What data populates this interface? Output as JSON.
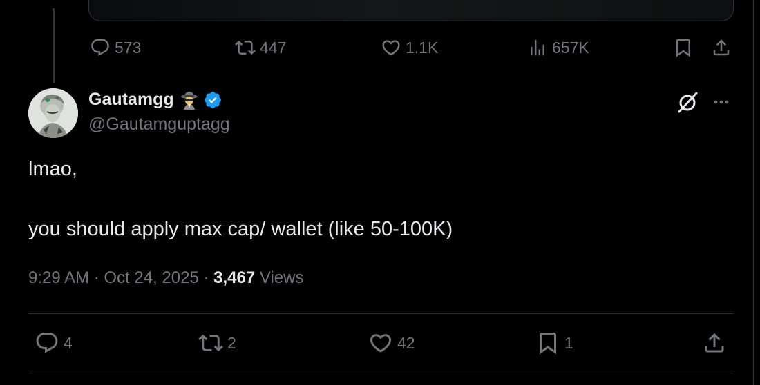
{
  "previous_post": {
    "actions": {
      "replies": "573",
      "reposts": "447",
      "likes": "1.1K",
      "views": "657K"
    }
  },
  "post": {
    "author": {
      "name": "Gautamgg",
      "handle": "@Gautamguptagg",
      "verified": true,
      "verified_color": "#1d9bf0"
    },
    "text_lines": [
      "lmao,",
      "you should apply max cap/ wallet (like 50-100K)"
    ],
    "meta": {
      "time": "9:29 AM",
      "separator": " · ",
      "date": "Oct 24, 2025",
      "views_count": "3,467",
      "views_label": "Views"
    },
    "actions": {
      "replies": "4",
      "reposts": "2",
      "likes": "42",
      "bookmarks": "1"
    }
  },
  "icons": {
    "reply": "reply-icon",
    "repost": "repost-icon",
    "like": "heart-icon",
    "views": "analytics-icon",
    "bookmark": "bookmark-icon",
    "share": "share-icon",
    "grok": "grok-icon",
    "more": "more-icon"
  },
  "colors": {
    "background": "#000000",
    "text_primary": "#e7e9ea",
    "text_secondary": "#71767b",
    "border": "#2f3336",
    "accent": "#1d9bf0"
  }
}
